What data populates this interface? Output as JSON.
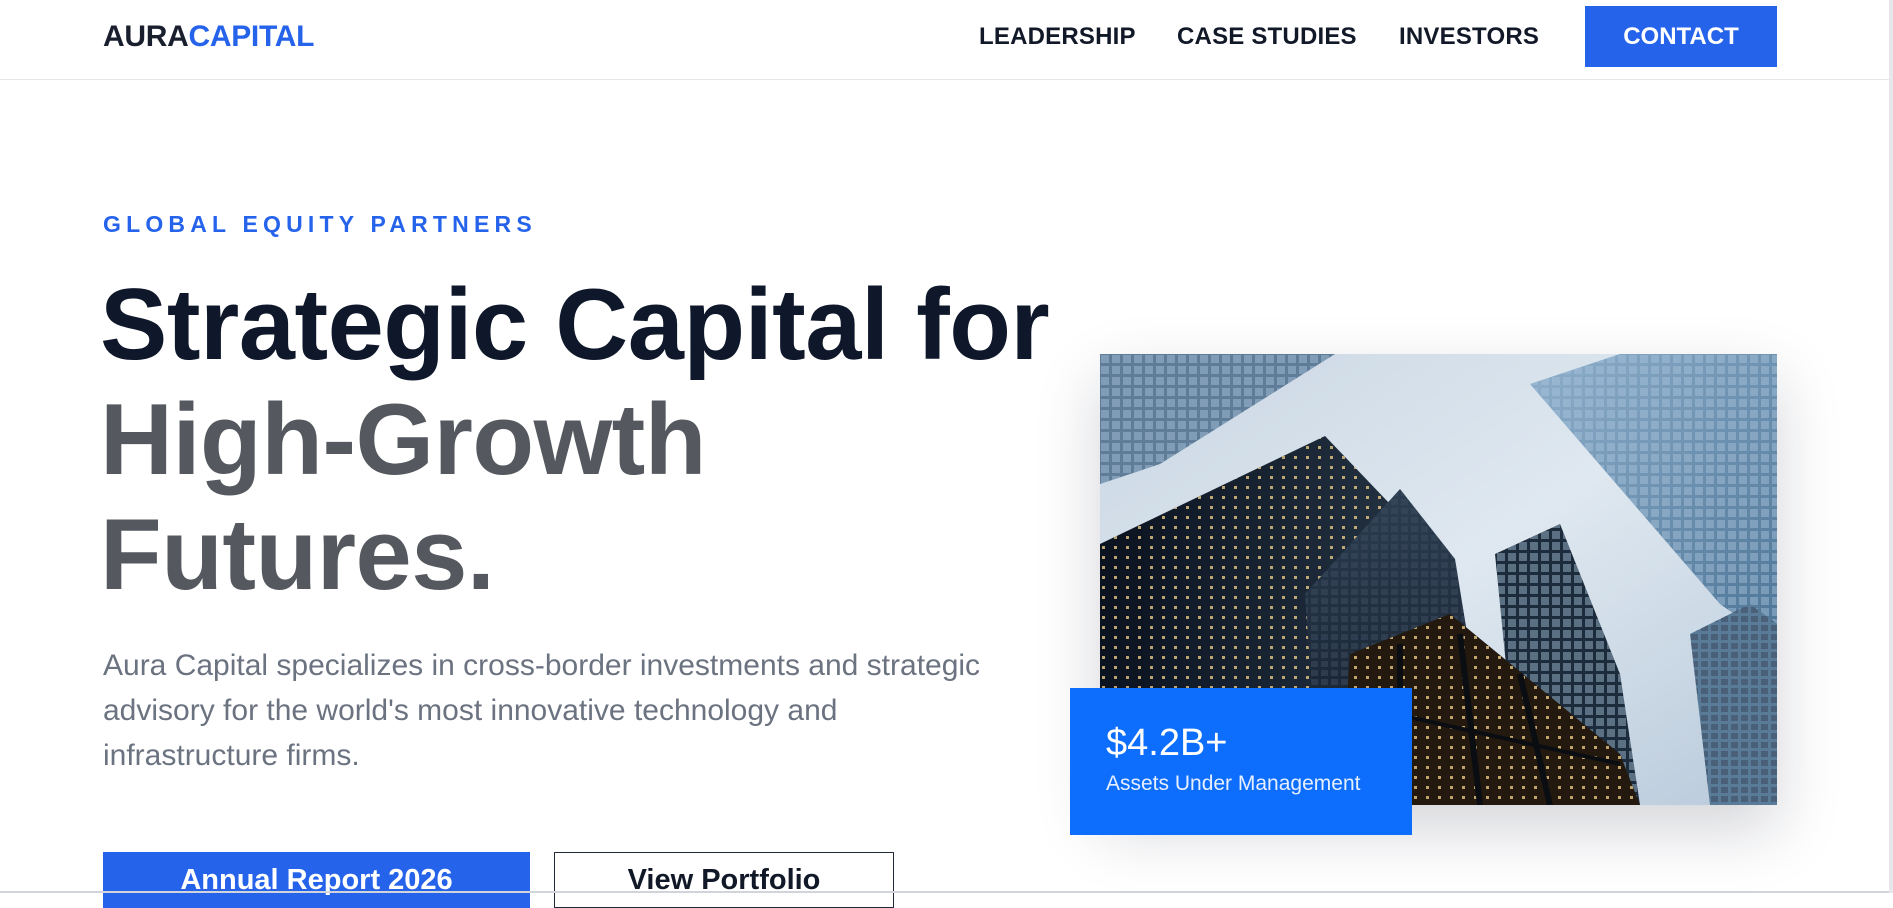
{
  "brand": {
    "logo_part1": "AURA",
    "logo_part2": "CAPITAL"
  },
  "nav": {
    "links": [
      "LEADERSHIP",
      "CASE STUDIES",
      "INVESTORS"
    ],
    "contact_label": "CONTACT"
  },
  "hero": {
    "eyebrow": "GLOBAL EQUITY PARTNERS",
    "headline_line1": "Strategic Capital for",
    "headline_line2": "High-Growth",
    "headline_line3": "Futures.",
    "lede": "Aura Capital specializes in cross-border investments and strategic advisory for the world's most innovative technology and infrastructure firms.",
    "primary_cta": "Annual Report 2026",
    "secondary_cta": "View Portfolio"
  },
  "stat": {
    "value": "$4.2B+",
    "label": "Assets Under Management"
  },
  "colors": {
    "accent": "#2563eb",
    "stat_bg": "#0d6efd",
    "text_dark": "#0f172a",
    "text_gray": "#55595f"
  },
  "image": {
    "subject": "skyscrapers-looking-up"
  }
}
